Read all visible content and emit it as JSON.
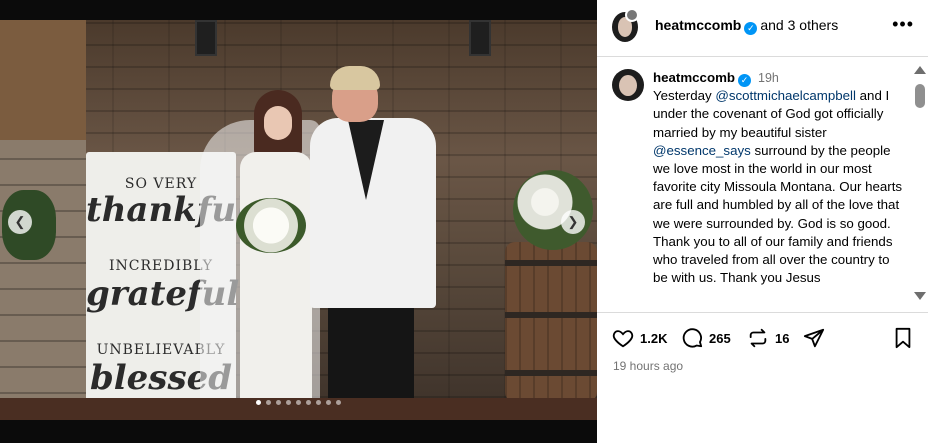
{
  "post": {
    "header": {
      "username": "heatmccomb",
      "others": "and 3 others",
      "more_label": "•••"
    },
    "caption": {
      "username": "heatmccomb",
      "time": "19h",
      "parts": {
        "p1": "Yesterday ",
        "m1": "@scottmichaelcampbell",
        "p2": " and I under the covenant of God got officially  married by my beautiful sister ",
        "m2": "@essence_says",
        "p3": " surround by the people we love most in the world in our most favorite city Missoula Montana. Our hearts are full and humbled by all of the love that we were surrounded by. God is so good. Thank you to all of our family and friends who traveled from all over the country to be with us. Thank you Jesus"
      }
    },
    "actions": {
      "likes": "1.2K",
      "comments": "265",
      "reposts": "16"
    },
    "timestamp": "19 hours ago"
  },
  "media": {
    "sign_lines": [
      "SO VERY",
      "thankful",
      "INCREDIBLY",
      "grateful",
      "UNBELIEVABLY",
      "blessed"
    ],
    "carousel_count": 9,
    "carousel_active_index": 0
  },
  "colors": {
    "verified": "#0095f6",
    "mention": "#00376b",
    "meta_gray": "#737373"
  }
}
